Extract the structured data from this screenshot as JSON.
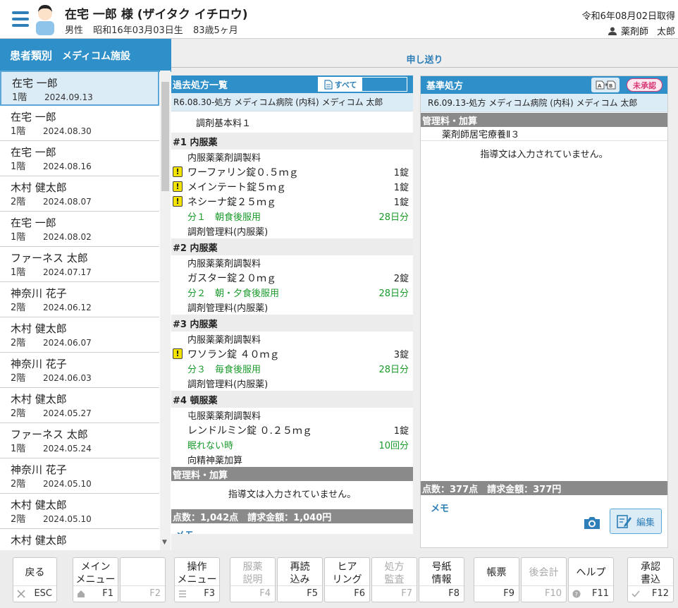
{
  "header": {
    "patient_name": "在宅 一郎 様 (ザイタク イチロウ)",
    "gender": "男性",
    "birth": "昭和16年03月03日生",
    "age": "83歳5ヶ月",
    "acquired_date": "令和6年08月02日取得",
    "pharmacist_role": "薬剤師",
    "pharmacist_name": "太郎"
  },
  "sidebar": {
    "title": "患者類別",
    "facility": "メディコム施設",
    "items": [
      {
        "name": "在宅 一郎",
        "floor": "1階",
        "date": "2024.09.13"
      },
      {
        "name": "在宅 一郎",
        "floor": "1階",
        "date": "2024.08.30"
      },
      {
        "name": "在宅 一郎",
        "floor": "1階",
        "date": "2024.08.16"
      },
      {
        "name": "木村 健太郎",
        "floor": "2階",
        "date": "2024.08.07"
      },
      {
        "name": "在宅 一郎",
        "floor": "1階",
        "date": "2024.08.02"
      },
      {
        "name": "ファーネス 太郎",
        "floor": "1階",
        "date": "2024.07.17"
      },
      {
        "name": "神奈川 花子",
        "floor": "2階",
        "date": "2024.06.12"
      },
      {
        "name": "木村 健太郎",
        "floor": "2階",
        "date": "2024.06.07"
      },
      {
        "name": "神奈川 花子",
        "floor": "2階",
        "date": "2024.06.03"
      },
      {
        "name": "木村 健太郎",
        "floor": "2階",
        "date": "2024.05.27"
      },
      {
        "name": "ファーネス 太郎",
        "floor": "1階",
        "date": "2024.05.24"
      },
      {
        "name": "神奈川 花子",
        "floor": "2階",
        "date": "2024.05.10"
      },
      {
        "name": "木村 健太郎",
        "floor": "2階",
        "date": "2024.05.10"
      },
      {
        "name": "木村 健太郎",
        "floor": "",
        "date": ""
      }
    ]
  },
  "tabs": {
    "handover": "申し送り"
  },
  "past": {
    "title": "過去処方一覧",
    "filter_all": "すべて",
    "rx_info": "R6.08.30-処方 メディコム病院 (内科) メディコム 太郎",
    "base_fee": "調剤基本料１",
    "groups": [
      {
        "head": "#1 内服薬",
        "prep": "内服薬薬剤調製料",
        "drugs": [
          {
            "name": "ワーファリン錠０.５ｍｇ",
            "qty": "1錠"
          },
          {
            "name": "メインテート錠５ｍｇ",
            "qty": "1錠"
          },
          {
            "name": "ネシーナ錠２５ｍｇ",
            "qty": "1錠"
          }
        ],
        "usage": "分１　朝食後服用",
        "days": "28日分",
        "mgmt": "調剤管理料(内服薬)"
      },
      {
        "head": "#2 内服薬",
        "prep": "内服薬薬剤調製料",
        "drugs": [
          {
            "name": "ガスター錠２０ｍｇ",
            "qty": "2錠"
          }
        ],
        "usage": "分２　朝・夕食後服用",
        "days": "28日分",
        "mgmt": "調剤管理料(内服薬)"
      },
      {
        "head": "#3 内服薬",
        "prep": "内服薬薬剤調製料",
        "drugs": [
          {
            "name": "ワソラン錠 ４０ｍｇ",
            "qty": "3錠"
          }
        ],
        "usage": "分３　毎食後服用",
        "days": "28日分",
        "mgmt": "調剤管理料(内服薬)"
      },
      {
        "head": "#4 頓服薬",
        "prep": "屯服薬薬剤調製料",
        "drugs": [
          {
            "name": "レンドルミン錠 ０.２５ｍｇ",
            "qty": "1錠"
          }
        ],
        "usage": "眠れない時",
        "days": "10回分",
        "mgmt": "向精神薬加算"
      }
    ],
    "fee_head": "管理料・加算",
    "no_guidance": "指導文は入力されていません。",
    "total": "点数：1,042点　請求金額：1,040円",
    "memo": "メモ"
  },
  "standard": {
    "title": "基準処方",
    "status": "未承認",
    "rx_info": "R6.09.13-処方 メディコム病院 (内科) メディコム 太郎",
    "fee_head": "管理料・加算",
    "fee_item": "薬剤師居宅療養Ⅱ３",
    "no_guidance": "指導文は入力されていません。",
    "total": "点数：377点　請求金額：377円",
    "memo": "メモ",
    "edit": "編集"
  },
  "footer": {
    "keys": [
      {
        "label": "戻る",
        "key": "ESC"
      },
      {
        "label": "メイン\nメニュー",
        "key": "F1"
      },
      {
        "label": "",
        "key": "F2"
      },
      {
        "label": "操作\nメニュー",
        "key": "F3"
      },
      {
        "label": "服薬\n説明",
        "key": "F4"
      },
      {
        "label": "再読\n込み",
        "key": "F5"
      },
      {
        "label": "ヒア\nリング",
        "key": "F6"
      },
      {
        "label": "処方\n監査",
        "key": "F7"
      },
      {
        "label": "号紙\n情報",
        "key": "F8"
      },
      {
        "label": "帳票",
        "key": "F9"
      },
      {
        "label": "後会計",
        "key": "F10"
      },
      {
        "label": "ヘルプ",
        "key": "F11"
      },
      {
        "label": "承認\n書込",
        "key": "F12"
      }
    ]
  },
  "colors": {
    "primary": "#2e8fc9",
    "accent_text": "#2e7fb8",
    "usage_green": "#1a9a2b",
    "warning": "#f2e300",
    "unapproved": "#d83c78"
  }
}
